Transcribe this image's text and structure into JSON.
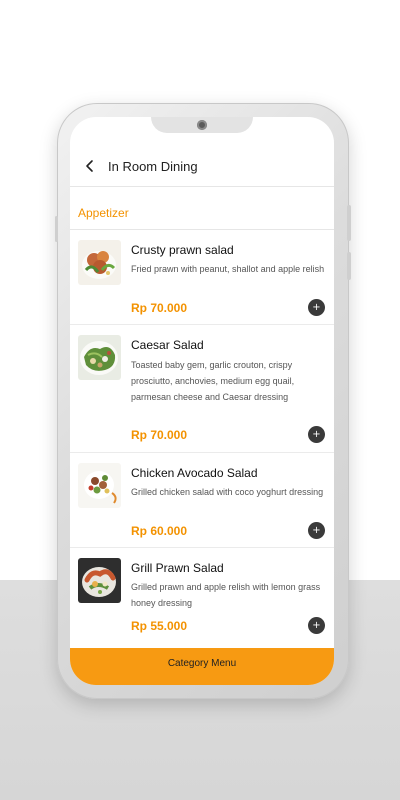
{
  "header": {
    "title": "In Room Dining"
  },
  "section": {
    "title": "Appetizer"
  },
  "items": [
    {
      "name": "Crusty prawn salad",
      "description": "Fried prawn with peanut, shallot and apple relish",
      "price": "Rp 70.000",
      "add_icon": "plus-icon"
    },
    {
      "name": "Caesar Salad",
      "description": "Toasted baby gem, garlic crouton, crispy prosciutto, anchovies, medium egg quail, parmesan cheese and Caesar dressing",
      "price": "Rp 70.000",
      "add_icon": "plus-icon"
    },
    {
      "name": "Chicken Avocado Salad",
      "description": "Grilled chicken salad with coco yoghurt dressing",
      "price": "Rp 60.000",
      "add_icon": "plus-icon"
    },
    {
      "name": "Grill Prawn Salad",
      "description": "Grilled prawn and apple relish with lemon grass honey dressing",
      "price": "Rp 55.000",
      "add_icon": "plus-icon"
    }
  ],
  "footer": {
    "button_label": "Category Menu"
  },
  "colors": {
    "accent": "#f39200",
    "button": "#f79a12",
    "add_button": "#3a3a3a"
  }
}
